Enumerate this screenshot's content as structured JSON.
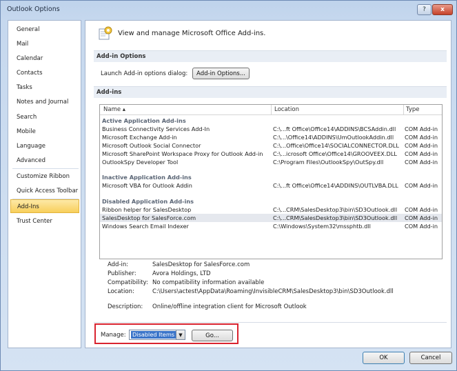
{
  "window": {
    "title": "Outlook Options",
    "help_glyph": "?",
    "close_glyph": "x"
  },
  "sidebar": {
    "items": [
      {
        "label": "General"
      },
      {
        "label": "Mail"
      },
      {
        "label": "Calendar"
      },
      {
        "label": "Contacts"
      },
      {
        "label": "Tasks"
      },
      {
        "label": "Notes and Journal"
      },
      {
        "label": "Search"
      },
      {
        "label": "Mobile"
      },
      {
        "label": "Language"
      },
      {
        "label": "Advanced"
      },
      {
        "label": "Customize Ribbon"
      },
      {
        "label": "Quick Access Toolbar"
      },
      {
        "label": "Add-Ins"
      },
      {
        "label": "Trust Center"
      }
    ],
    "selected": "Add-Ins"
  },
  "header": {
    "text": "View and manage Microsoft Office Add-ins.",
    "icon": "addins-icon"
  },
  "addin_options": {
    "section_title": "Add-in Options",
    "launch_label": "Launch Add-in options dialog:",
    "button_label": "Add-in Options..."
  },
  "addins": {
    "section_title": "Add-ins",
    "columns": {
      "name": "Name ▴",
      "location": "Location",
      "type": "Type"
    },
    "groups": [
      {
        "title": "Active Application Add-ins",
        "rows": [
          {
            "name": "Business Connectivity Services Add-In",
            "location": "C:\\...ft Office\\Office14\\ADDINS\\BCSAddin.dll",
            "type": "COM Add-in"
          },
          {
            "name": "Microsoft Exchange Add-in",
            "location": "C:\\...\\Office14\\ADDINS\\UmOutlookAddin.dll",
            "type": "COM Add-in"
          },
          {
            "name": "Microsoft Outlook Social Connector",
            "location": "C:\\...Office\\Office14\\SOCIALCONNECTOR.DLL",
            "type": "COM Add-in"
          },
          {
            "name": "Microsoft SharePoint Workspace Proxy for Outlook Add-in",
            "location": "C:\\...icrosoft Office\\Office14\\GROOVEEX.DLL",
            "type": "COM Add-in"
          },
          {
            "name": "OutlookSpy Developer Tool",
            "location": "C:\\Program Files\\OutlookSpy\\OutSpy.dll",
            "type": "COM Add-in"
          }
        ]
      },
      {
        "title": "Inactive Application Add-ins",
        "rows": [
          {
            "name": "Microsoft VBA for Outlook Addin",
            "location": "C:\\...ft Office\\Office14\\ADDINS\\OUTLVBA.DLL",
            "type": "COM Add-in"
          }
        ]
      },
      {
        "title": "Disabled Application Add-ins",
        "rows": [
          {
            "name": "Ribbon helper for SalesDesktop",
            "location": "C:\\...CRM\\SalesDesktop3\\bin\\SD3Outlook.dll",
            "type": "COM Add-in"
          },
          {
            "name": "SalesDesktop for SalesForce.com",
            "location": "C:\\...CRM\\SalesDesktop3\\bin\\SD3Outlook.dll",
            "type": "COM Add-in"
          },
          {
            "name": "Windows Search Email Indexer",
            "location": "C:\\Windows\\System32\\mssphtb.dll",
            "type": "COM Add-in"
          }
        ]
      }
    ],
    "selected_row": "SalesDesktop for SalesForce.com"
  },
  "details": {
    "addin_label": "Add-in:",
    "addin_value": "SalesDesktop for SalesForce.com",
    "publisher_label": "Publisher:",
    "publisher_value": "Avora Holdings, LTD",
    "compat_label": "Compatibility:",
    "compat_value": "No compatibility information available",
    "location_label": "Location:",
    "location_value": "C:\\Users\\actest\\AppData\\Roaming\\InvisibleCRM\\SalesDesktop3\\bin\\SD3Outlook.dll",
    "desc_label": "Description:",
    "desc_value": "Online/offline integration client for Microsoft Outlook"
  },
  "manage": {
    "label": "Manage:",
    "selected": "Disabled Items",
    "go_label": "Go..."
  },
  "footer": {
    "ok_label": "OK",
    "cancel_label": "Cancel"
  }
}
